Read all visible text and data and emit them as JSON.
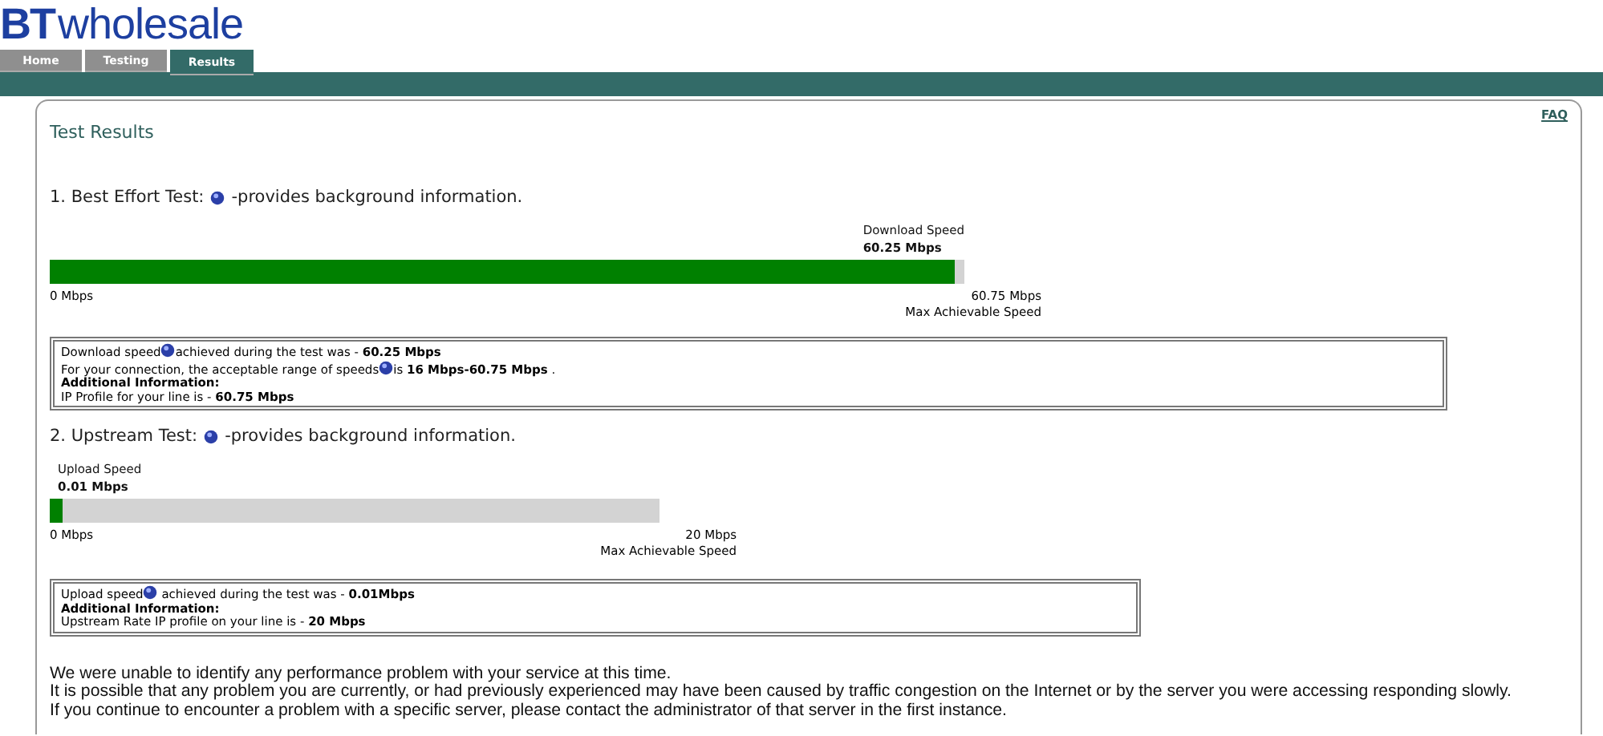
{
  "logo": {
    "brand": "BT",
    "name": "wholesale"
  },
  "tabs": [
    {
      "label": "Home",
      "selected": false
    },
    {
      "label": "Testing",
      "selected": false
    },
    {
      "label": "Results",
      "selected": true
    }
  ],
  "panel": {
    "title": "Test Results",
    "faq": "FAQ"
  },
  "tests": [
    {
      "title": "1. Best Effort Test:",
      "note": "-provides background information.",
      "speed_label": "Download Speed",
      "speed": "60.25 Mbps",
      "level": 0.99,
      "min": "0 Mbps",
      "max": "60.75 Mbps",
      "max_label": "Max Achievable Speed",
      "info": [
        {
          "lead": "Download speed",
          "help": true,
          "text": "achieved during the test was - **60.25 Mbps**"
        },
        {
          "lead": "For your connection, the acceptable range of speeds",
          "help": true,
          "text": "is **16 Mbps-60.75 Mbps** ."
        },
        {
          "lead": "Additional Information:",
          "help": false,
          "kind": "heading"
        },
        {
          "lead": "IP Profile for your line is - **60.75 Mbps**",
          "help": false
        }
      ]
    },
    {
      "title": "2. Upstream Test:",
      "note": "-provides background information.",
      "speed_label": "Upload Speed",
      "speed": "0.01 Mbps",
      "level": 0.02,
      "min": "0 Mbps",
      "max": "20 Mbps",
      "max_label": "Max Achievable Speed",
      "info": [
        {
          "lead": "Upload speed",
          "help": true,
          "text": " achieved during the test was - **0.01Mbps**"
        },
        {
          "lead": "Additional Information:",
          "help": false,
          "kind": "heading"
        },
        {
          "lead": "Upstream Rate IP profile on your line is - **20 Mbps**",
          "help": false
        }
      ]
    }
  ],
  "summary": [
    "We were unable to identify any performance problem with your service at this time.",
    "It is possible that any problem you are currently, or had previously experienced may have been caused by traffic congestion on the Internet or by the server you were accessing responding slowly.",
    "If you continue to encounter a problem with a specific server, please contact the administrator of that server in the first instance."
  ]
}
